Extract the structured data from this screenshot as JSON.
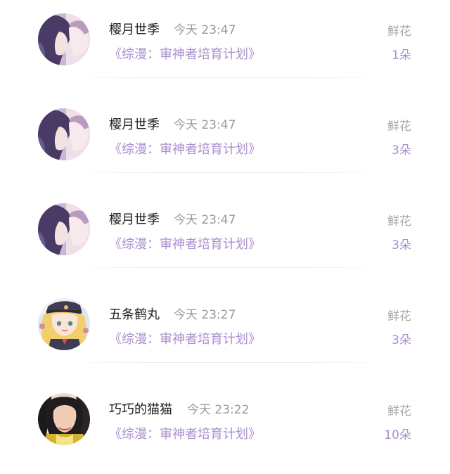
{
  "list": {
    "items": [
      {
        "avatar": "anime-couple-avatar",
        "name": "樱月世季",
        "time": "今天 23:47",
        "book": "《综漫：审神者培育计划》",
        "gift_type": "鲜花",
        "gift_count": "1朵"
      },
      {
        "avatar": "anime-couple-avatar",
        "name": "樱月世季",
        "time": "今天 23:47",
        "book": "《综漫：审神者培育计划》",
        "gift_type": "鲜花",
        "gift_count": "3朵"
      },
      {
        "avatar": "anime-couple-avatar",
        "name": "樱月世季",
        "time": "今天 23:47",
        "book": "《综漫：审神者培育计划》",
        "gift_type": "鲜花",
        "gift_count": "3朵"
      },
      {
        "avatar": "anime-blonde-girl-avatar",
        "name": "五条鹤丸",
        "time": "今天 23:27",
        "book": "《综漫：审神者培育计划》",
        "gift_type": "鲜花",
        "gift_count": "3朵"
      },
      {
        "avatar": "photo-person-avatar",
        "name": "巧巧的猫猫",
        "time": "今天 23:22",
        "book": "《综漫：审神者培育计划》",
        "gift_type": "鲜花",
        "gift_count": "10朵"
      }
    ]
  },
  "colors": {
    "accent": "#a98fcf",
    "name_text": "#1f1f1f",
    "meta_text": "#9a9a9a"
  }
}
